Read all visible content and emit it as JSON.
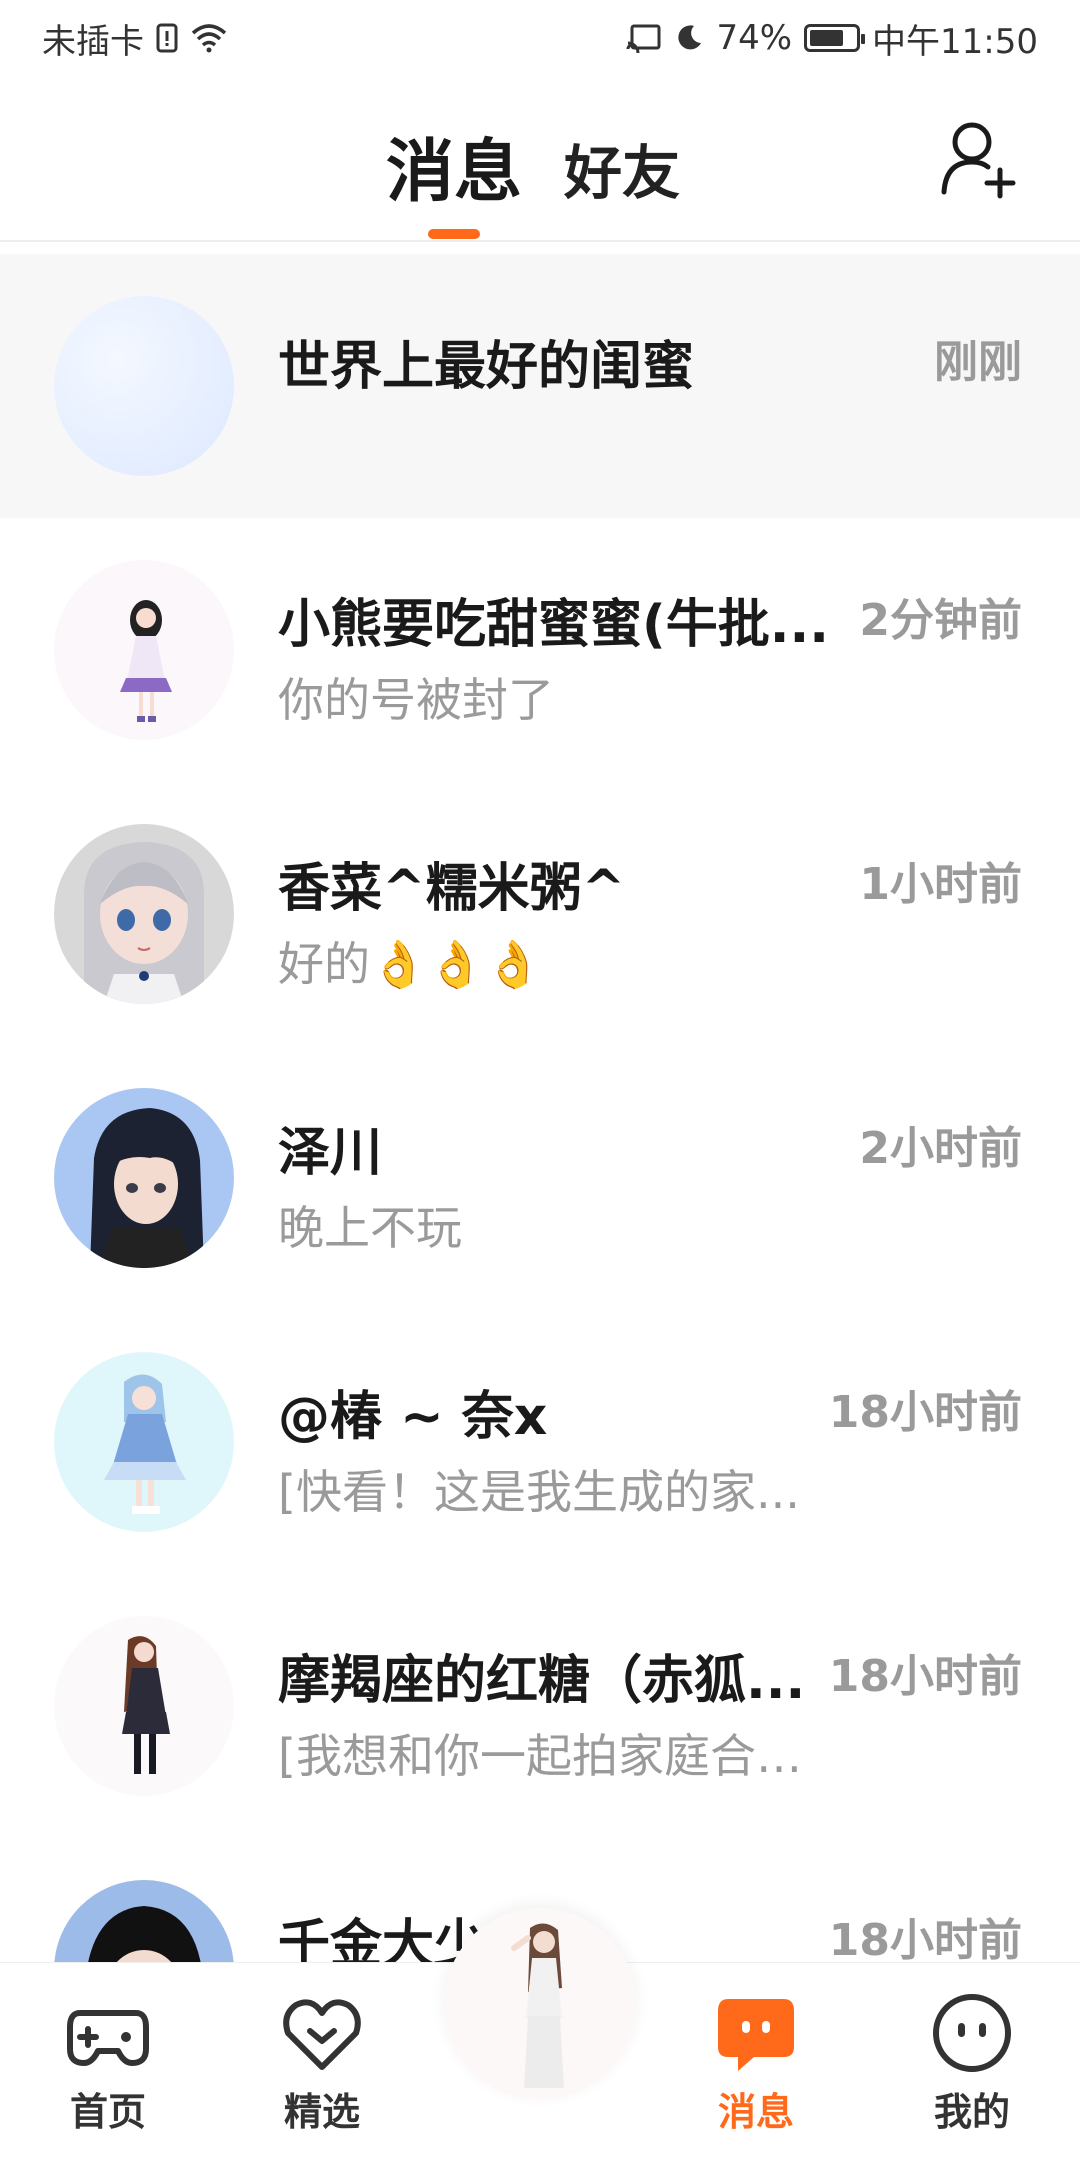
{
  "status_bar": {
    "carrier": "未插卡",
    "battery": "74%",
    "battery_level": 0.74,
    "time": "中午11:50"
  },
  "header": {
    "tab_messages": "消息",
    "tab_friends": "好友",
    "accent": "#ff6a1a"
  },
  "messages": [
    {
      "name": "世界上最好的闺蜜",
      "time": "刚刚",
      "preview": ""
    },
    {
      "name": "小熊要吃甜蜜蜜(牛批...",
      "time": "2分钟前",
      "preview": "你的号被封了"
    },
    {
      "name": "香菜^糯米粥^",
      "time": "1小时前",
      "preview": "好的👌👌👌"
    },
    {
      "name": "泽川",
      "time": "2小时前",
      "preview": "晚上不玩"
    },
    {
      "name": "@椿 ~ 奈x",
      "time": "18小时前",
      "preview": "[快看！这是我生成的家..."
    },
    {
      "name": "摩羯座的红糖（赤狐...",
      "time": "18小时前",
      "preview": "[我想和你一起拍家庭合照]"
    },
    {
      "name": "千金大少",
      "time": "18小时前",
      "preview": ""
    }
  ],
  "bottom_nav": {
    "home": "首页",
    "featured": "精选",
    "messages": "消息",
    "mine": "我的"
  }
}
